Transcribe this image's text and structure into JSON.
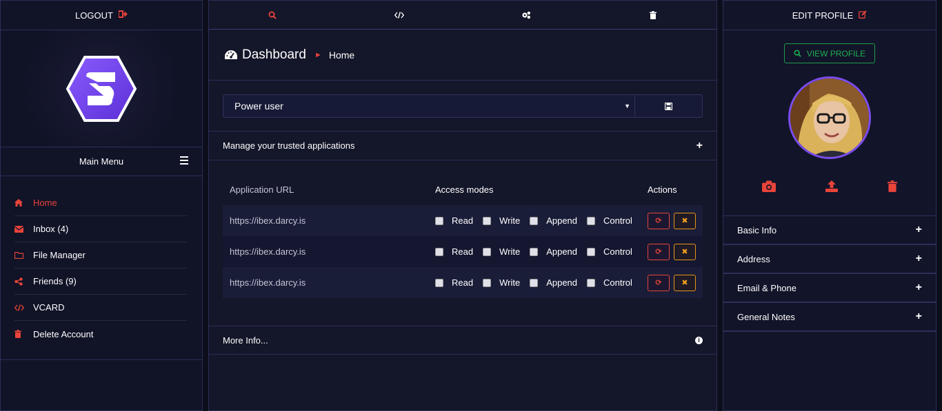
{
  "left": {
    "logout_label": "LOGOUT",
    "logo_letter": "S",
    "menu_title": "Main Menu",
    "items": [
      {
        "label": "Home",
        "icon": "home-icon",
        "active": true
      },
      {
        "label": "Inbox (4)",
        "icon": "envelope-icon",
        "active": false
      },
      {
        "label": "File Manager",
        "icon": "folder-icon",
        "active": false
      },
      {
        "label": "Friends (9)",
        "icon": "share-icon",
        "active": false
      },
      {
        "label": "VCARD",
        "icon": "code-icon",
        "active": false
      },
      {
        "label": "Delete Account",
        "icon": "trash-icon",
        "active": false
      }
    ]
  },
  "center": {
    "toolbar_icons": [
      "search-icon",
      "code-icon",
      "cogs-icon",
      "trash-icon"
    ],
    "title": "Dashboard",
    "breadcrumb": "Home",
    "select_value": "Power user",
    "trusted_title": "Manage your trusted applications",
    "table": {
      "headers": [
        "Application URL",
        "Access modes",
        "Actions"
      ],
      "modes": [
        "Read",
        "Write",
        "Append",
        "Control"
      ],
      "rows": [
        {
          "url": "https://ibex.darcy.is"
        },
        {
          "url": "https://ibex.darcy.is"
        },
        {
          "url": "https://ibex.darcy.is"
        }
      ]
    },
    "more_info": "More Info..."
  },
  "right": {
    "edit_label": "EDIT PROFILE",
    "view_label": "VIEW PROFILE",
    "sections": [
      "Basic Info",
      "Address",
      "Email & Phone",
      "General Notes"
    ]
  },
  "colors": {
    "accent_red": "#e8443a",
    "accent_purple": "#7a4cf0",
    "accent_green": "#1fb04f",
    "accent_orange": "#f0a020",
    "background": "#0d0e1c"
  }
}
